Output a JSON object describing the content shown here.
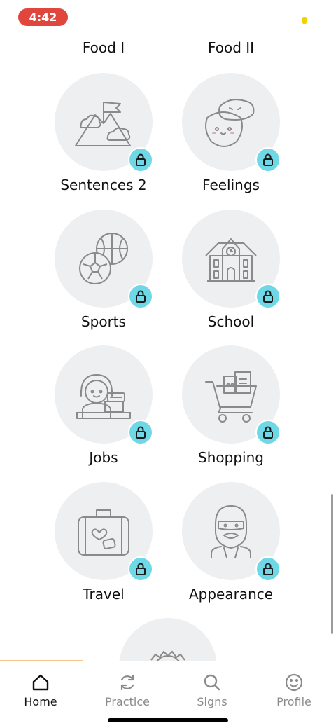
{
  "status_bar": {
    "time": "4:42"
  },
  "top_labels": [
    "Food I",
    "Food II"
  ],
  "lessons": [
    {
      "label": "Sentences 2",
      "icon": "mountain-flag-icon",
      "locked": true
    },
    {
      "label": "Feelings",
      "icon": "emotion-faces-icon",
      "locked": true
    },
    {
      "label": "Sports",
      "icon": "soccer-basketball-icon",
      "locked": true
    },
    {
      "label": "School",
      "icon": "school-building-icon",
      "locked": true
    },
    {
      "label": "Jobs",
      "icon": "cashier-icon",
      "locked": true
    },
    {
      "label": "Shopping",
      "icon": "shopping-cart-icon",
      "locked": true
    },
    {
      "label": "Travel",
      "icon": "suitcase-icon",
      "locked": true
    },
    {
      "label": "Appearance",
      "icon": "bearded-man-icon",
      "locked": true
    }
  ],
  "tabs": [
    {
      "label": "Home",
      "icon": "home-icon",
      "active": true
    },
    {
      "label": "Practice",
      "icon": "refresh-icon",
      "active": false
    },
    {
      "label": "Signs",
      "icon": "search-icon",
      "active": false
    },
    {
      "label": "Profile",
      "icon": "smiley-icon",
      "active": false
    }
  ],
  "colors": {
    "lock_badge": "#6fd8e6",
    "bubble": "#eeeff1",
    "status_pill": "#e0463c",
    "progress": "#f5c98e"
  }
}
